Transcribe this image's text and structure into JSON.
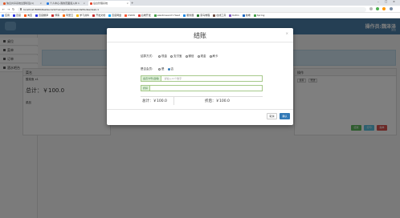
{
  "browser": {
    "tabs": [
      {
        "label": "信息共享系统全部标签(1)",
        "color": "#e05a2b"
      },
      {
        "label": "个人中心-我的页面载入中 1",
        "color": "#2b7de0"
      },
      {
        "label": "后台管理系统",
        "color": "#e0432b"
      }
    ],
    "url": "localhost:8080/Restaurant/management/desk/dsfdsdas/desk-1",
    "bookmarks": [
      {
        "label": "应用",
        "color": "#4285f4"
      },
      {
        "label": "百度",
        "color": "#2932e1"
      },
      {
        "label": "淘宝",
        "color": "#ff5000"
      },
      {
        "label": "百度翻译",
        "color": "#2932e1"
      },
      {
        "label": "博客",
        "color": "#c62828"
      },
      {
        "label": "阿里云",
        "color": "#ff6a00"
      },
      {
        "label": "学习资料",
        "color": "#f4b400"
      },
      {
        "label": "开发文档",
        "color": "#c62828"
      },
      {
        "label": "百度网盘",
        "color": "#06a7ff"
      },
      {
        "label": "CSDN",
        "color": "#fc5531"
      },
      {
        "label": "后端开发",
        "color": "#e53935"
      },
      {
        "label": "elasticsearch Head",
        "color": "#43a047"
      },
      {
        "label": "服务器",
        "color": "#1e88e5"
      },
      {
        "label": "菜鸟教程",
        "color": "#2e7d32"
      },
      {
        "label": "在线工具",
        "color": "#6d4c41"
      },
      {
        "label": "Kotlin",
        "color": "#7e57c2"
      },
      {
        "label": "前端",
        "color": "#1565c0"
      },
      {
        "label": "Spring",
        "color": "#43a047"
      }
    ]
  },
  "app": {
    "header": {
      "user": "操作员:魏泽泽",
      "sub": "退出"
    },
    "sidebar": [
      {
        "label": "桌位",
        "icon": "desktop-icon"
      },
      {
        "label": "菜单",
        "icon": "menu-icon"
      },
      {
        "label": "订单",
        "icon": "order-icon"
      },
      {
        "label": "酒水吧台",
        "icon": "bar-icon"
      }
    ],
    "left_panel": {
      "header": "菜名",
      "row": "酸菜鱼 x1",
      "total": "总计：￥100.0",
      "meta": "菜品"
    },
    "right_panel": {
      "header": "操作",
      "mini_buttons": [
        "退菜",
        "赠送"
      ],
      "actions": [
        {
          "label": "结账",
          "color": "#5cb85c"
        },
        {
          "label": "打印",
          "color": "#5bc0de"
        },
        {
          "label": "撤单",
          "color": "#d9534f"
        }
      ]
    }
  },
  "modal": {
    "title": "结账",
    "pay_method_label": "结算方式：",
    "pay_methods": [
      {
        "label": "现金",
        "selected": false
      },
      {
        "label": "支付宝",
        "selected": false
      },
      {
        "label": "微信",
        "selected": false
      },
      {
        "label": "现金",
        "selected": false
      },
      {
        "label": "刷卡",
        "selected": false
      }
    ],
    "member_label": "是否会员：",
    "member_options": [
      {
        "label": "是",
        "selected": false
      },
      {
        "label": "否",
        "selected": true
      }
    ],
    "member_card_addon": "会员卡号(选填)",
    "member_card_placeholder": "请输入11个数字",
    "discount_addon": "折扣",
    "discount_placeholder": "",
    "total_label": "总计：￥100.0",
    "discounted_label": "折后：￥100.0",
    "cancel": "取消",
    "confirm": "确认"
  }
}
